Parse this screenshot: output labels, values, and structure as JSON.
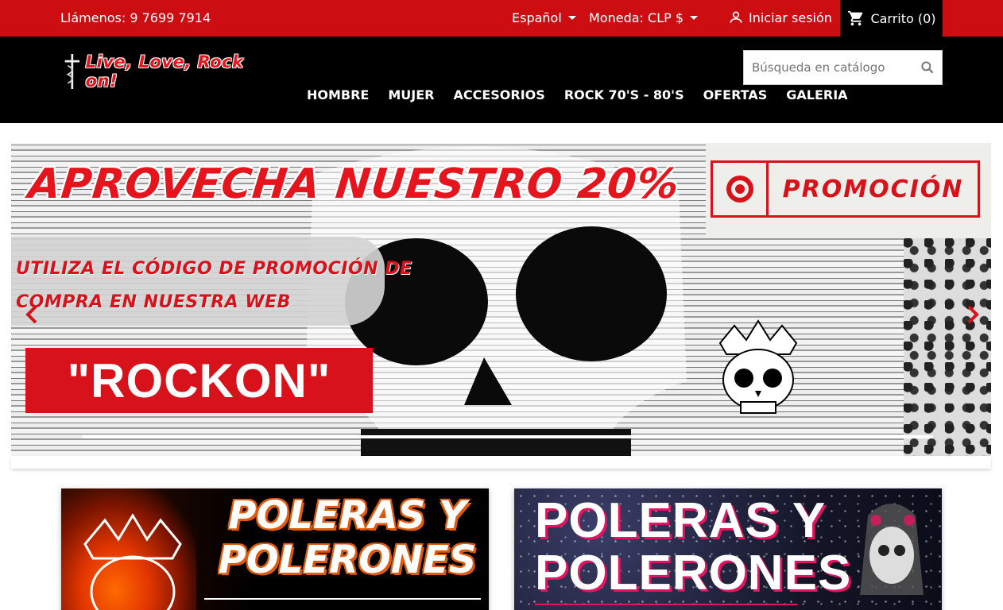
{
  "topbar": {
    "phone": "Llámenos: 9 7699 7914",
    "language": "Español",
    "currency": "Moneda: CLP $",
    "signin": "Iniciar sesión",
    "cart": "Carrito (0)"
  },
  "header": {
    "logo_text": "Live, Love, Rock on!",
    "search_placeholder": "Búsqueda en catálogo",
    "nav": [
      "HOMBRE",
      "MUJER",
      "ACCESORIOS",
      "ROCK 70'S - 80'S",
      "OFERTAS",
      "GALERIA"
    ]
  },
  "slider": {
    "headline": "APROVECHA NUESTRO 20%",
    "promo_label": "PROMOCIÓN",
    "subline_1": "UTILIZA EL CÓDIGO DE PROMOCIÓN DE",
    "subline_2": "COMPRA EN NUESTRA WEB",
    "code": "\"ROCKON\""
  },
  "banners": [
    {
      "title": "POLERAS Y\nPOLERONES"
    },
    {
      "title": "POLERAS Y\nPOLERONES"
    }
  ],
  "colors": {
    "brand_red": "#cc0d12",
    "header_black": "#000000",
    "accent_orange": "#e05a0e",
    "accent_pink": "#e1155f"
  }
}
